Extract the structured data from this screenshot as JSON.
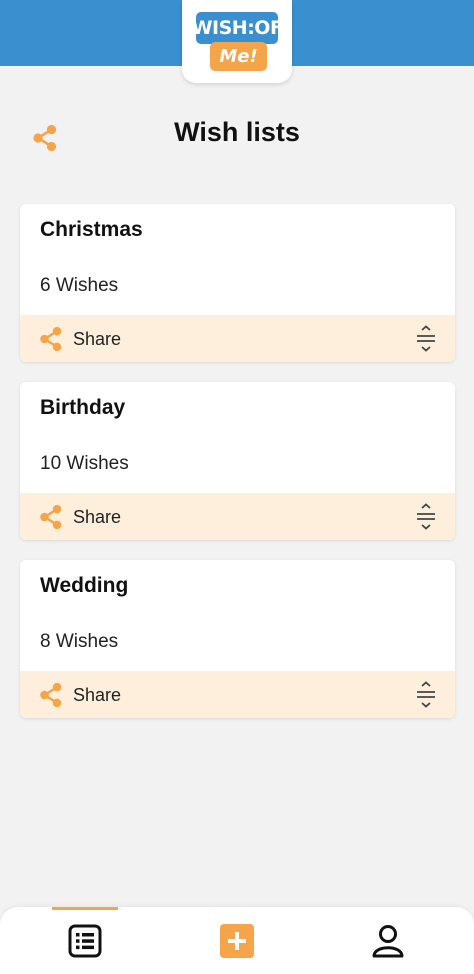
{
  "app": {
    "logo_line1": "WISH:OF",
    "logo_line2": "Me!"
  },
  "header": {
    "title": "Wish lists",
    "share_icon": "share-icon"
  },
  "lists": [
    {
      "name": "Christmas",
      "count": "6 Wishes",
      "share_label": "Share"
    },
    {
      "name": "Birthday",
      "count": "10 Wishes",
      "share_label": "Share"
    },
    {
      "name": "Wedding",
      "count": "8 Wishes",
      "share_label": "Share"
    }
  ],
  "bottom_nav": {
    "items": [
      "list-icon",
      "add-icon",
      "profile-icon"
    ],
    "active": "list-icon"
  },
  "colors": {
    "brand_blue": "#3a8fce",
    "accent_orange": "#f6a449",
    "card_footer": "#fdefdb",
    "background": "#f2f2f2"
  }
}
